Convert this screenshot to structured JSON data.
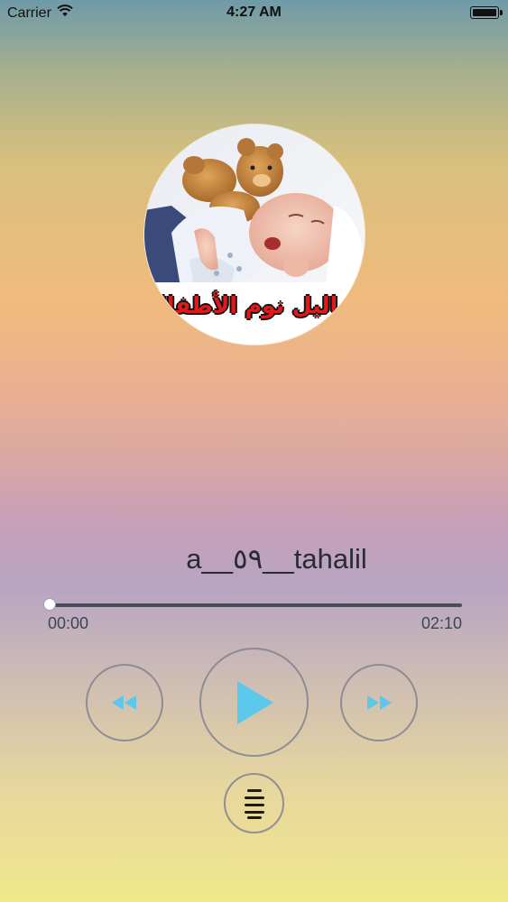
{
  "status_bar": {
    "carrier": "Carrier",
    "time": "4:27 AM",
    "battery_level": 1.0
  },
  "player": {
    "artwork_caption": "تهاليل نوم الأطفال",
    "track_title": "a__٥٩__tahalil",
    "elapsed": "00:00",
    "duration": "02:10",
    "progress": 0.0
  },
  "controls": {
    "rewind_icon": "rewind-icon",
    "play_icon": "play-icon",
    "forward_icon": "fast-forward-icon",
    "playlist_icon": "playlist-icon",
    "accent_color": "#5bc8ec"
  }
}
